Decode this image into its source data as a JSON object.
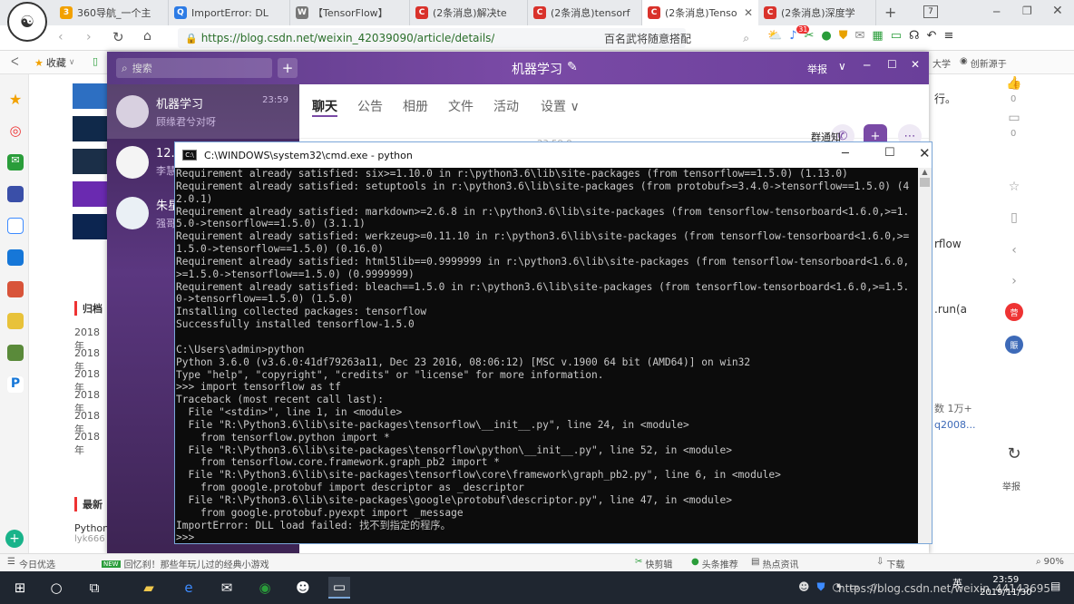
{
  "browser": {
    "tabs": [
      {
        "label": "360导航_一个主",
        "color": "#f2a100",
        "glyph": "3"
      },
      {
        "label": "ImportError: DL",
        "color": "#2c7be5",
        "glyph": "Q"
      },
      {
        "label": "【TensorFlow】",
        "color": "#777777",
        "glyph": "W"
      },
      {
        "label": "(2条消息)解决te",
        "color": "#d9322b",
        "glyph": "C"
      },
      {
        "label": "(2条消息)tensorf",
        "color": "#d9322b",
        "glyph": "C"
      },
      {
        "label": "(2条消息)Tenso",
        "color": "#d9322b",
        "glyph": "C",
        "active": true
      },
      {
        "label": "(2条消息)深度学",
        "color": "#d9322b",
        "glyph": "C"
      }
    ],
    "tab_count": "7",
    "url": "https://blog.csdn.net/weixin_42039090/article/details/",
    "search_text": "百名武将随意搭配",
    "bookmark_collect": "收藏",
    "right_bar_labels": [
      "大学",
      "创新源于"
    ],
    "badge_count": "31"
  },
  "page": {
    "right_text_1": "行。",
    "right_text_2": "rflow",
    "right_text_3": ".run(a",
    "right_text_4": "数 1万+",
    "right_text_5": "q2008...",
    "group_notice": "群通知",
    "side_count_1": "0",
    "side_count_2": "0",
    "archive_heading": "归档",
    "archive_years": [
      "2018年",
      "2018年",
      "2018年",
      "2018年",
      "2018年",
      "2018年"
    ],
    "recent_heading": "最新",
    "recent_item_1": "Python",
    "recent_item_2": "lyk666",
    "report_label": "举报"
  },
  "qq": {
    "search_placeholder": "搜索",
    "title": "机器学习",
    "report": "举报",
    "conversations": [
      {
        "name": "机器学习",
        "time": "23:59",
        "sub": "顾缘君兮对呀"
      },
      {
        "name": "12.0",
        "time": "",
        "sub": "李慧"
      },
      {
        "name": "朱星",
        "time": "",
        "sub": "强哥"
      }
    ],
    "tabs": [
      "聊天",
      "公告",
      "相册",
      "文件",
      "活动",
      "设置 ∨"
    ],
    "chat_stamp": "23:59:0"
  },
  "cmd": {
    "title": "C:\\WINDOWS\\system32\\cmd.exe - python",
    "lines": [
      "Requirement already satisfied: six>=1.10.0 in r:\\python3.6\\lib\\site-packages (from tensorflow==1.5.0) (1.13.0)",
      "Requirement already satisfied: setuptools in r:\\python3.6\\lib\\site-packages (from protobuf>=3.4.0->tensorflow==1.5.0) (4",
      "2.0.1)",
      "Requirement already satisfied: markdown>=2.6.8 in r:\\python3.6\\lib\\site-packages (from tensorflow-tensorboard<1.6.0,>=1.",
      "5.0->tensorflow==1.5.0) (3.1.1)",
      "Requirement already satisfied: werkzeug>=0.11.10 in r:\\python3.6\\lib\\site-packages (from tensorflow-tensorboard<1.6.0,>=",
      "1.5.0->tensorflow==1.5.0) (0.16.0)",
      "Requirement already satisfied: html5lib==0.9999999 in r:\\python3.6\\lib\\site-packages (from tensorflow-tensorboard<1.6.0,",
      ">=1.5.0->tensorflow==1.5.0) (0.9999999)",
      "Requirement already satisfied: bleach==1.5.0 in r:\\python3.6\\lib\\site-packages (from tensorflow-tensorboard<1.6.0,>=1.5.",
      "0->tensorflow==1.5.0) (1.5.0)",
      "Installing collected packages: tensorflow",
      "Successfully installed tensorflow-1.5.0",
      "",
      "C:\\Users\\admin>python",
      "Python 3.6.0 (v3.6.0:41df79263a11, Dec 23 2016, 08:06:12) [MSC v.1900 64 bit (AMD64)] on win32",
      "Type \"help\", \"copyright\", \"credits\" or \"license\" for more information.",
      ">>> import tensorflow as tf",
      "Traceback (most recent call last):",
      "  File \"<stdin>\", line 1, in <module>",
      "  File \"R:\\Python3.6\\lib\\site-packages\\tensorflow\\__init__.py\", line 24, in <module>",
      "    from tensorflow.python import *",
      "  File \"R:\\Python3.6\\lib\\site-packages\\tensorflow\\python\\__init__.py\", line 52, in <module>",
      "    from tensorflow.core.framework.graph_pb2 import *",
      "  File \"R:\\Python3.6\\lib\\site-packages\\tensorflow\\core\\framework\\graph_pb2.py\", line 6, in <module>",
      "    from google.protobuf import descriptor as _descriptor",
      "  File \"R:\\Python3.6\\lib\\site-packages\\google\\protobuf\\descriptor.py\", line 47, in <module>",
      "    from google.protobuf.pyexpt import _message",
      "ImportError: DLL load failed: 找不到指定的程序。",
      ">>>"
    ]
  },
  "statusbar": {
    "today": "今日优选",
    "news_badge": "NEW",
    "news": "回忆刹！那些年玩儿过的经典小游戏",
    "quick_cut": "快剪辑",
    "headline": "头条推荐",
    "hot": "热点资讯",
    "download": "下载",
    "zoom": "90%"
  },
  "taskbar": {
    "time": "23:59",
    "date": "2019/11/30",
    "lang": "英",
    "watermark": "https://blog.csdn.net/weixin_44143695"
  }
}
